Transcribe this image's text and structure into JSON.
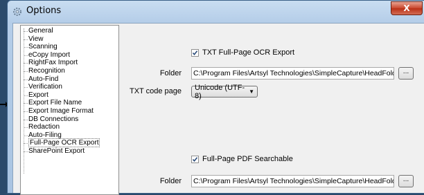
{
  "window": {
    "title": "Options",
    "close_label": "X"
  },
  "tree": {
    "items": [
      "General",
      "View",
      "Scanning",
      "eCopy Import",
      "RightFax Import",
      "Recognition",
      "Auto-Find",
      "Verification",
      "Export",
      "Export File Name",
      "Export Image Format",
      "DB Connections",
      "Redaction",
      "Auto-Filing",
      "Full-Page OCR Export",
      "SharePoint Export"
    ],
    "selected": "Full-Page OCR Export"
  },
  "txt_section": {
    "checkbox_label": "TXT Full-Page OCR Export",
    "checked": true,
    "folder_label": "Folder",
    "folder_value": "C:\\Program Files\\Artsyl Technologies\\SimpleCapture\\HeadFolder\\Expo",
    "browse_label": "...",
    "code_page_label": "TXT code page",
    "code_page_value": "Unicode (UTF-8)"
  },
  "pdf_section": {
    "checkbox_label": "Full-Page PDF Searchable",
    "checked": true,
    "folder_label": "Folder",
    "folder_value": "C:\\Program Files\\Artsyl Technologies\\SimpleCapture\\HeadFolder\\Expo",
    "browse_label": "..."
  }
}
